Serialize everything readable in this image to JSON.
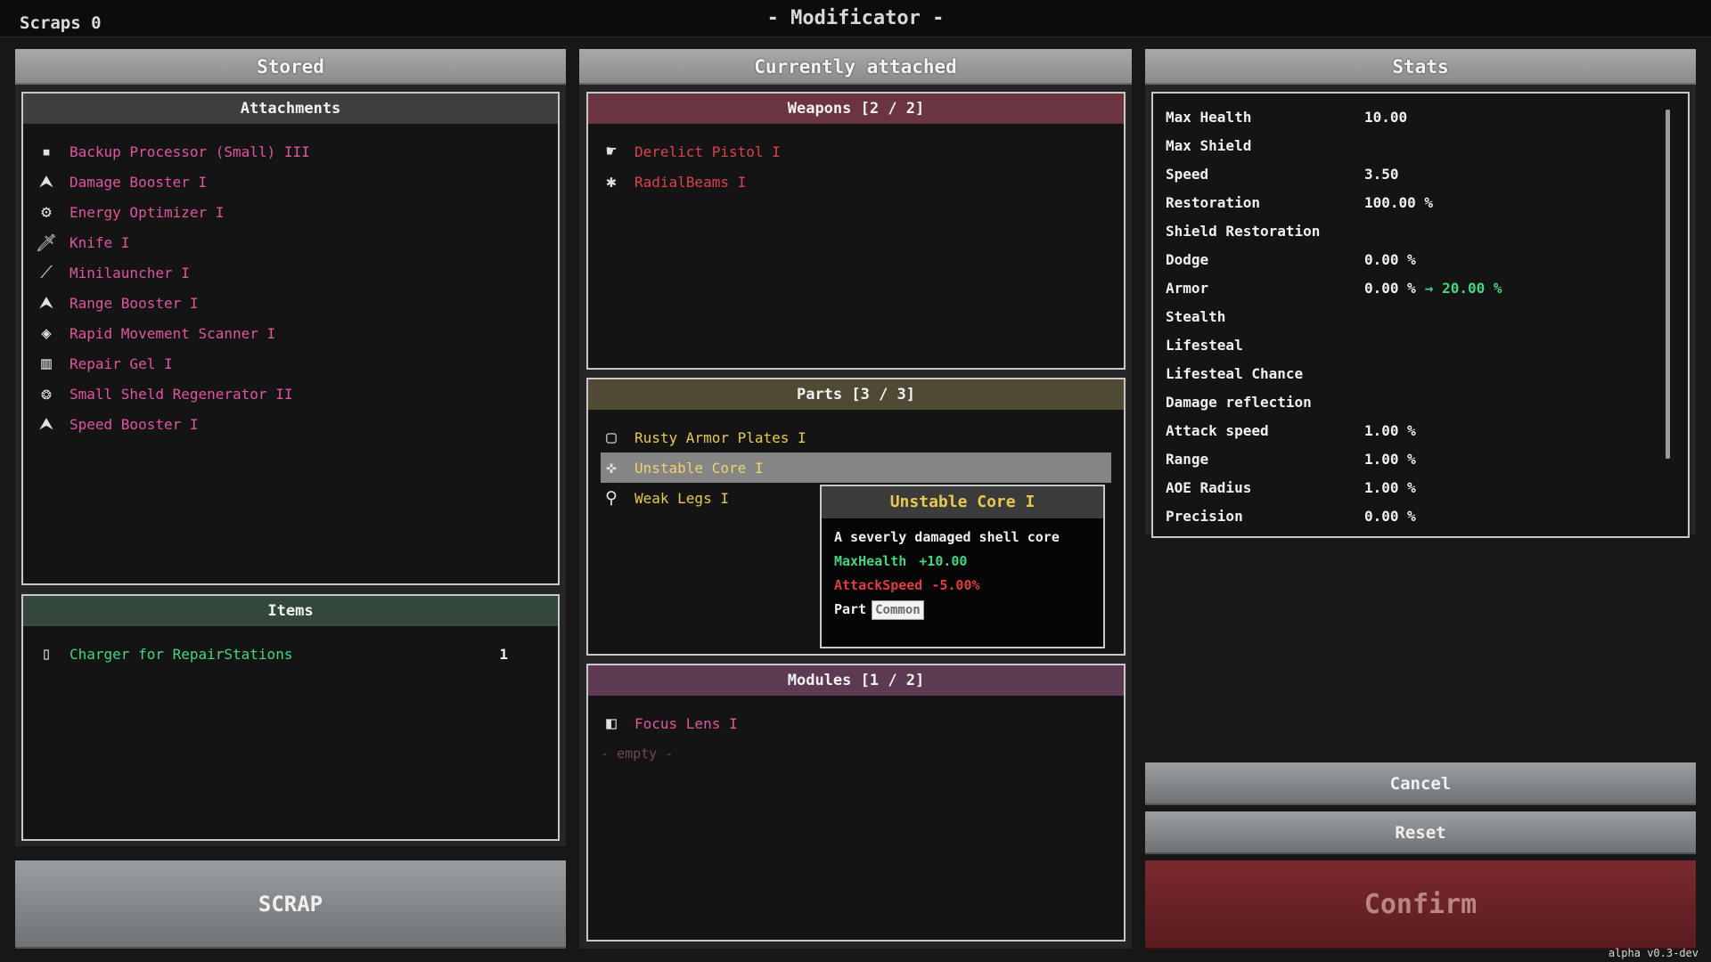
{
  "topbar": {
    "scraps": "Scraps 0",
    "title": "- Modificator -"
  },
  "stored": {
    "header": "Stored",
    "attachments": {
      "header": "Attachments",
      "items": [
        {
          "label": "Backup Processor (Small) III",
          "icon": "processor-icon",
          "glyph": "■"
        },
        {
          "label": "Damage Booster I",
          "icon": "booster-icon",
          "glyph": "⮝"
        },
        {
          "label": "Energy Optimizer I",
          "icon": "optimizer-icon",
          "glyph": "⚙"
        },
        {
          "label": "Knife I",
          "icon": "knife-icon",
          "glyph": "🗡"
        },
        {
          "label": "Minilauncher I",
          "icon": "launcher-icon",
          "glyph": "⟋"
        },
        {
          "label": "Range Booster I",
          "icon": "booster-icon",
          "glyph": "⮝"
        },
        {
          "label": "Rapid Movement Scanner I",
          "icon": "scanner-icon",
          "glyph": "◈"
        },
        {
          "label": "Repair Gel I",
          "icon": "gel-icon",
          "glyph": "▥"
        },
        {
          "label": "Small Sheld Regenerator II",
          "icon": "regenerator-icon",
          "glyph": "❂"
        },
        {
          "label": "Speed Booster I",
          "icon": "booster-icon",
          "glyph": "⮝"
        }
      ]
    },
    "items": {
      "header": "Items",
      "list": [
        {
          "label": "Charger for RepairStations",
          "count": "1",
          "icon": "charger-icon",
          "glyph": "▯"
        }
      ]
    },
    "scrap_button": "SCRAP"
  },
  "attached": {
    "header": "Currently attached",
    "weapons": {
      "header": "Weapons [2 / 2]",
      "items": [
        {
          "label": "Derelict Pistol I",
          "icon": "pistol-icon",
          "glyph": "☛"
        },
        {
          "label": "RadialBeams I",
          "icon": "radial-beams-icon",
          "glyph": "✱"
        }
      ]
    },
    "parts": {
      "header": "Parts [3 / 3]",
      "items": [
        {
          "label": "Rusty Armor Plates I",
          "icon": "armor-plate-icon",
          "glyph": "▢"
        },
        {
          "label": "Unstable Core I",
          "icon": "core-icon",
          "glyph": "✜"
        },
        {
          "label": "Weak Legs I",
          "icon": "legs-icon",
          "glyph": "⚲"
        }
      ]
    },
    "modules": {
      "header": "Modules [1 / 2]",
      "items": [
        {
          "label": "Focus Lens I",
          "icon": "lens-icon",
          "glyph": "◧"
        }
      ],
      "empty": "- empty -"
    }
  },
  "tooltip": {
    "title": "Unstable Core I",
    "description": "A severly damaged shell core",
    "stat1_name": "MaxHealth",
    "stat1_value": "+10.00",
    "stat2_name": "AttackSpeed",
    "stat2_value": "-5.00%",
    "type_label": "Part",
    "rarity": "Common"
  },
  "stats": {
    "header": "Stats",
    "rows": [
      {
        "name": "Max Health",
        "value": "10.00",
        "new": ""
      },
      {
        "name": "Max Shield",
        "value": "",
        "new": ""
      },
      {
        "name": "Speed",
        "value": "3.50",
        "new": ""
      },
      {
        "name": "Restoration",
        "value": "100.00 %",
        "new": ""
      },
      {
        "name": "Shield Restoration",
        "value": "",
        "new": ""
      },
      {
        "name": "Dodge",
        "value": "0.00 %",
        "new": ""
      },
      {
        "name": "Armor",
        "value": "0.00 %",
        "new": "→ 20.00 %"
      },
      {
        "name": "Stealth",
        "value": "",
        "new": ""
      },
      {
        "name": "Lifesteal",
        "value": "",
        "new": ""
      },
      {
        "name": "Lifesteal Chance",
        "value": "",
        "new": ""
      },
      {
        "name": "Damage reflection",
        "value": "",
        "new": ""
      },
      {
        "name": "Attack speed",
        "value": "1.00 %",
        "new": ""
      },
      {
        "name": "Range",
        "value": "1.00 %",
        "new": ""
      },
      {
        "name": "AOE Radius",
        "value": "1.00 %",
        "new": ""
      },
      {
        "name": "Precision",
        "value": "0.00 %",
        "new": ""
      }
    ],
    "cancel": "Cancel",
    "reset": "Reset",
    "confirm": "Confirm"
  },
  "version": "alpha v0.3-dev"
}
